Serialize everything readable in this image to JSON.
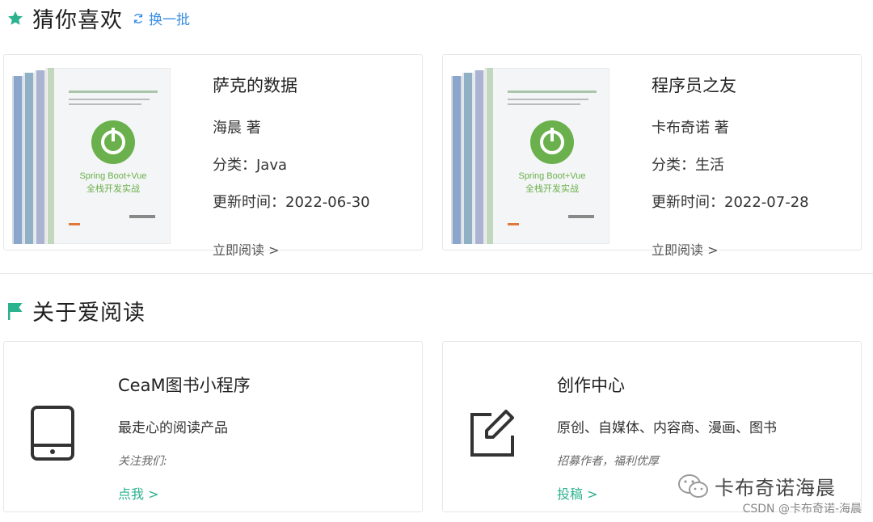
{
  "colors": {
    "accent_green": "#2bb28e",
    "link_blue": "#3a8ee6",
    "border": "#e6e6e6"
  },
  "recommend": {
    "title": "猜你喜欢",
    "icon": "star-icon",
    "refresh_label": "换一批",
    "books": [
      {
        "title": "萨克的数据",
        "author": "海晨 著",
        "category": "分类：Java",
        "updated": "更新时间：2022-06-30",
        "read_label": "立即阅读 >",
        "cover_text": "Spring Boot+Vue",
        "cover_sub": "全栈开发实战"
      },
      {
        "title": "程序员之友",
        "author": "卡布奇诺 著",
        "category": "分类：生活",
        "updated": "更新时间：2022-07-28",
        "read_label": "立即阅读 >",
        "cover_text": "Spring Boot+Vue",
        "cover_sub": "全栈开发实战"
      }
    ]
  },
  "about": {
    "title": "关于爱阅读",
    "icon": "flag-icon",
    "cards": [
      {
        "icon": "tablet-icon",
        "title": "CeaM图书小程序",
        "desc": "最走心的阅读产品",
        "note": "关注我们:",
        "link": "点我 >"
      },
      {
        "icon": "edit-icon",
        "title": "创作中心",
        "desc": "原创、自媒体、内容商、漫画、图书",
        "note": "招募作者，福利优厚",
        "link": "投稿 >"
      }
    ]
  },
  "watermark": {
    "text": "卡布奇诺海晨",
    "csdn": "CSDN @卡布奇诺-海晨"
  }
}
